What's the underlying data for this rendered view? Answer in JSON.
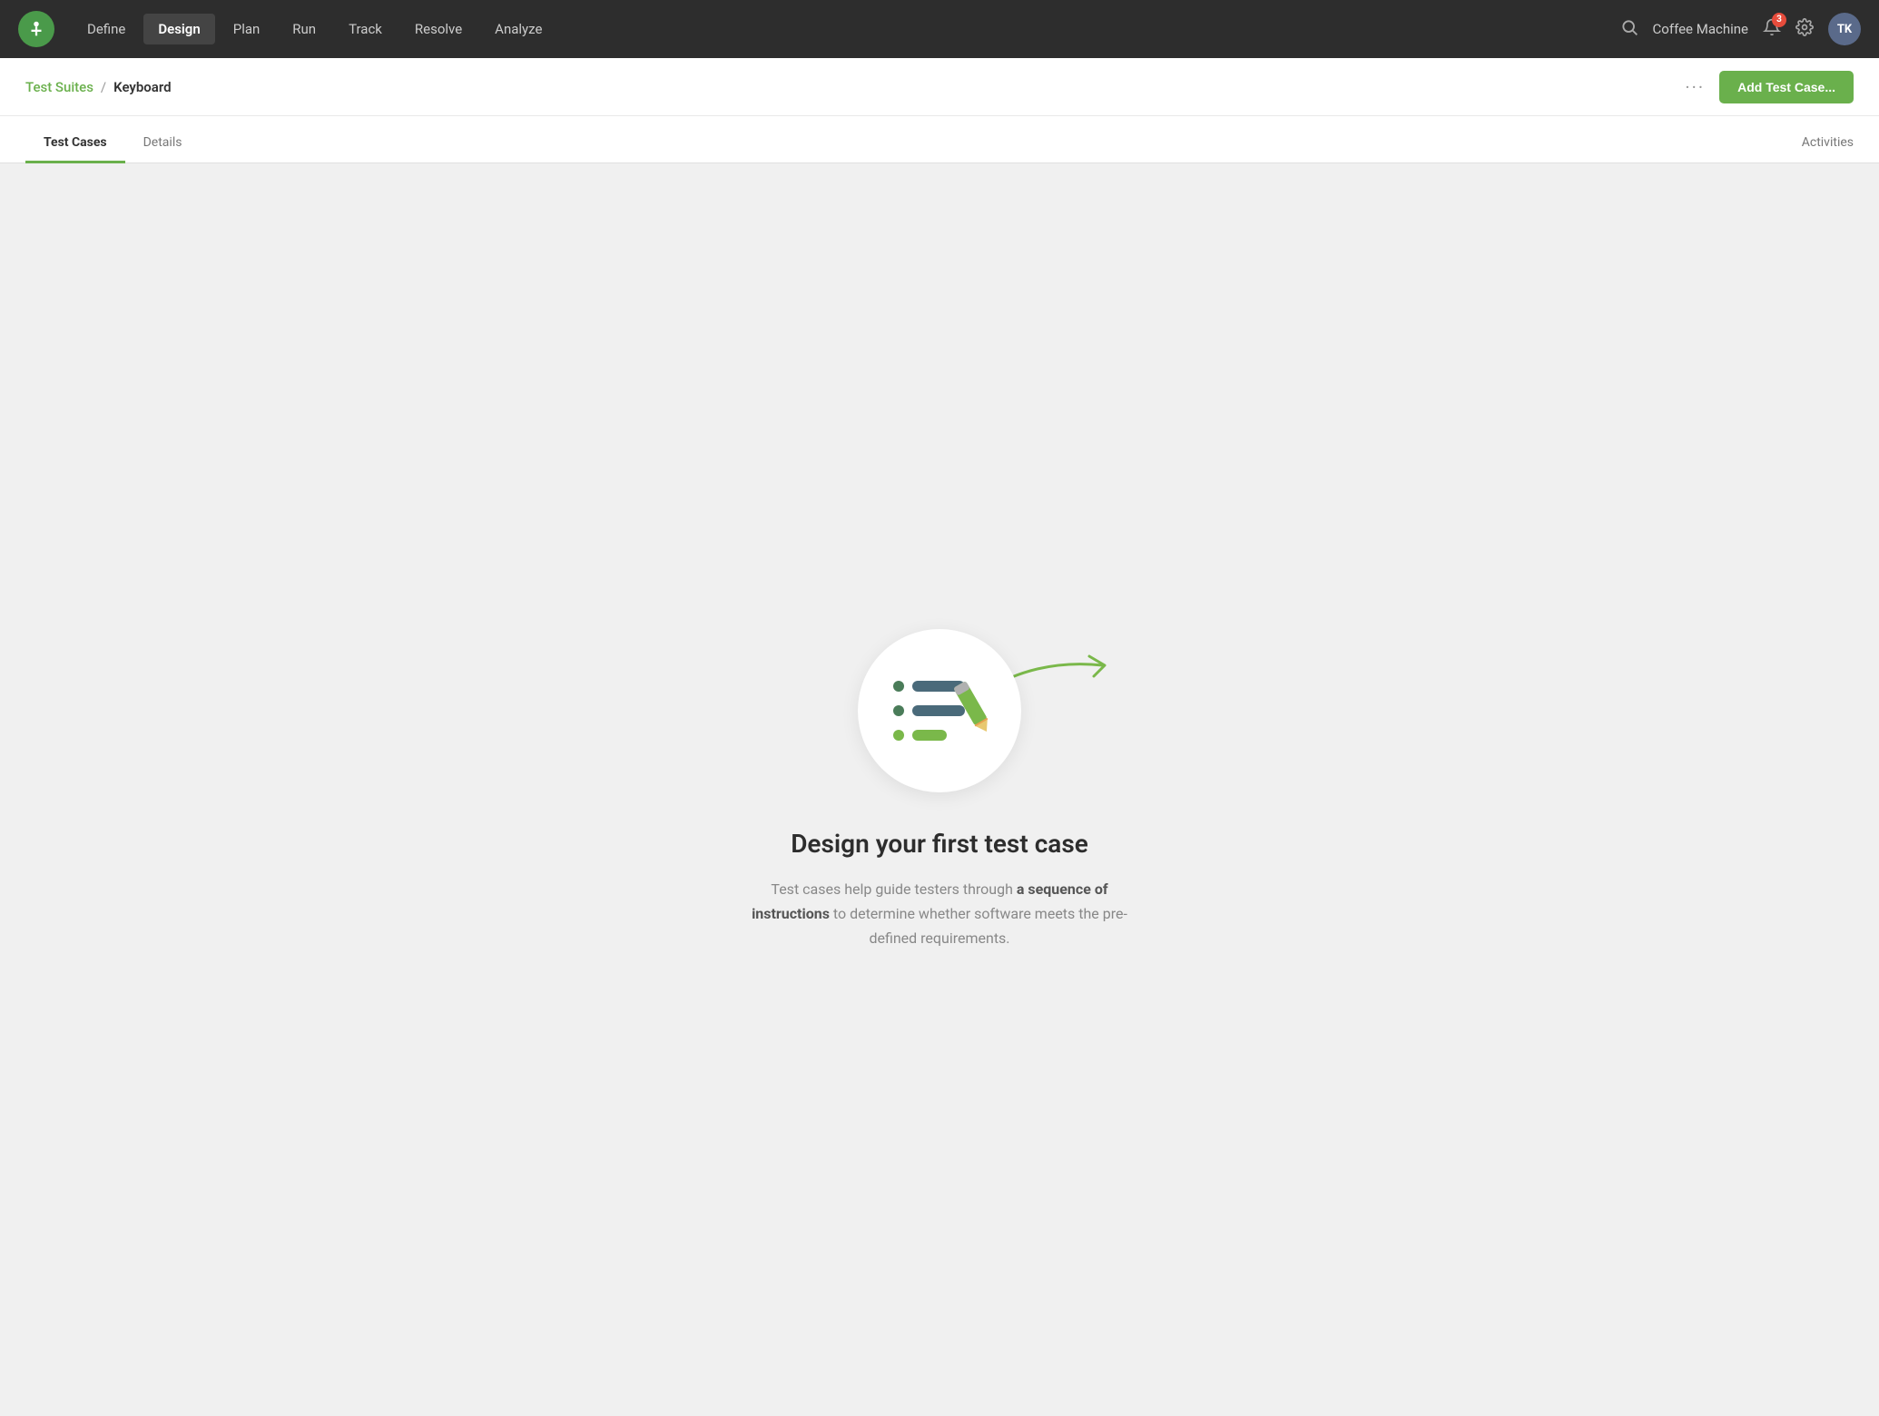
{
  "navbar": {
    "logo_alt": "TestRail Logo",
    "nav_items": [
      {
        "label": "Define",
        "active": false
      },
      {
        "label": "Design",
        "active": true
      },
      {
        "label": "Plan",
        "active": false
      },
      {
        "label": "Run",
        "active": false
      },
      {
        "label": "Track",
        "active": false
      },
      {
        "label": "Resolve",
        "active": false
      },
      {
        "label": "Analyze",
        "active": false
      }
    ],
    "project": "Coffee Machine",
    "bell_count": "3",
    "avatar_initials": "TK"
  },
  "breadcrumb": {
    "link_label": "Test Suites",
    "separator": "/",
    "current": "Keyboard"
  },
  "actions": {
    "more_icon": "···",
    "add_button": "Add Test Case..."
  },
  "tabs": {
    "tab_list": [
      {
        "label": "Test Cases",
        "active": true
      },
      {
        "label": "Details",
        "active": false
      }
    ],
    "activities_label": "Activities"
  },
  "empty_state": {
    "title": "Design your first test case",
    "description_plain": "Test cases help guide testers through ",
    "description_bold": "a sequence of instructions",
    "description_end": " to determine whether software meets the pre-defined requirements."
  }
}
